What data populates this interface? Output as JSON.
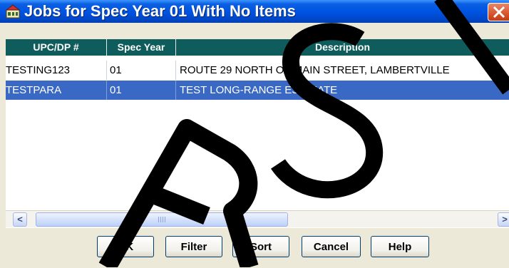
{
  "window": {
    "title": "Jobs for Spec Year 01 With No Items",
    "icon": "app-icon",
    "close_icon": "close-icon"
  },
  "table": {
    "columns": [
      "UPC/DP #",
      "Spec Year",
      "Description"
    ],
    "rows": [
      {
        "upc": "TESTING123",
        "spec_year": "01",
        "description": "ROUTE 29 NORTH OF MAIN STREET, LAMBERTVILLE",
        "selected": false
      },
      {
        "upc": "TESTPARA",
        "spec_year": "01",
        "description": "TEST LONG-RANGE ESTIMATE",
        "selected": true
      }
    ],
    "header_color": "#0e5c5b",
    "selection_color": "#3a68c5"
  },
  "scrollbar": {
    "left_icon": "scroll-left-icon",
    "right_icon": "scroll-right-icon"
  },
  "buttons": {
    "ok": "OK",
    "filter": "Filter",
    "sort": "Sort",
    "cancel": "Cancel",
    "help": "Help"
  },
  "watermark": {
    "text": "RSL",
    "color": "#000000"
  }
}
